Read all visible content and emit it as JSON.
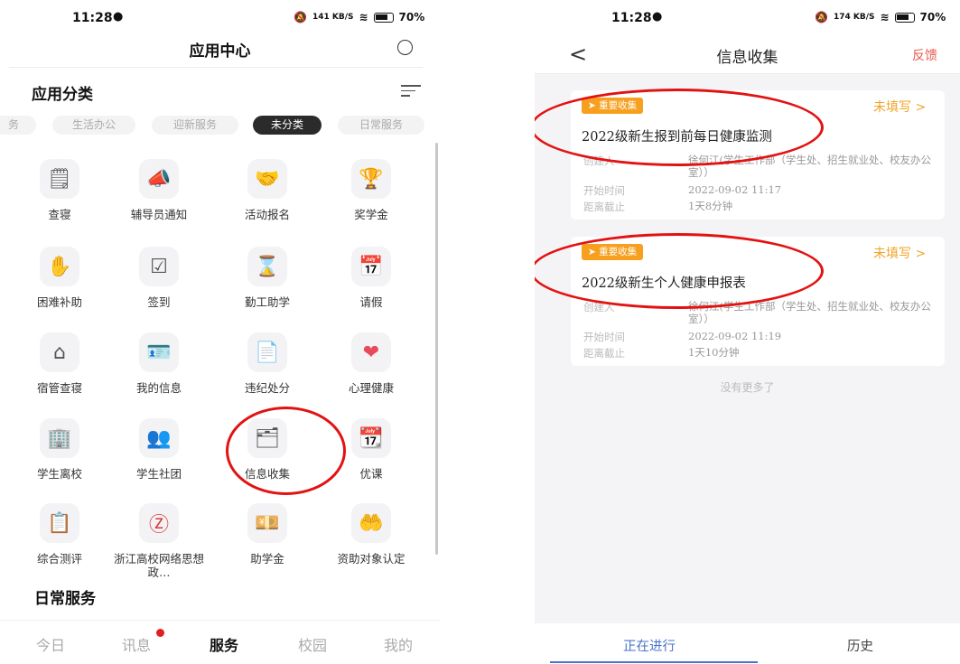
{
  "left": {
    "status": {
      "time": "11:28",
      "speed": "141 KB/S",
      "battery": "70%"
    },
    "title": "应用中心",
    "category_title": "应用分类",
    "chips": [
      "务",
      "生活办公",
      "迎新服务",
      "未分类",
      "日常服务"
    ],
    "active_chip": "未分类",
    "apps": [
      {
        "label": "查寝",
        "icon": "clipboard-check-icon",
        "color": "#555555",
        "glyph": "🗒"
      },
      {
        "label": "辅导员通知",
        "icon": "megaphone-icon",
        "color": "#555555",
        "glyph": "📣"
      },
      {
        "label": "活动报名",
        "icon": "handshake-icon",
        "color": "#555555",
        "glyph": "🤝"
      },
      {
        "label": "奖学金",
        "icon": "trophy-icon",
        "color": "#f07a2a",
        "glyph": "🏆"
      },
      {
        "label": "困难补助",
        "icon": "hand-coin-icon",
        "color": "#f0b84a",
        "glyph": "✋"
      },
      {
        "label": "签到",
        "icon": "checkin-icon",
        "color": "#555555",
        "glyph": "☑"
      },
      {
        "label": "勤工助学",
        "icon": "hourglass-icon",
        "color": "#3cb4a0",
        "glyph": "⌛"
      },
      {
        "label": "请假",
        "icon": "calendar-clock-icon",
        "color": "#555555",
        "glyph": "📅"
      },
      {
        "label": "宿管查寝",
        "icon": "home-heart-icon",
        "color": "#555555",
        "glyph": "⌂"
      },
      {
        "label": "我的信息",
        "icon": "id-card-icon",
        "color": "#555555",
        "glyph": "🪪"
      },
      {
        "label": "违纪处分",
        "icon": "document-red-icon",
        "color": "#e8503a",
        "glyph": "📄"
      },
      {
        "label": "心理健康",
        "icon": "heart-icon",
        "color": "#e84a5a",
        "glyph": "❤"
      },
      {
        "label": "学生离校",
        "icon": "building-icon",
        "color": "#3a6ad8",
        "glyph": "🏢"
      },
      {
        "label": "学生社团",
        "icon": "group-icon",
        "color": "#e87a3a",
        "glyph": "👥"
      },
      {
        "label": "信息收集",
        "icon": "info-collect-icon",
        "color": "#555555",
        "glyph": "🗂"
      },
      {
        "label": "优课",
        "icon": "vooc-calendar-icon",
        "color": "#555555",
        "glyph": "📆"
      },
      {
        "label": "综合测评",
        "icon": "resume-icon",
        "color": "#2aa8a0",
        "glyph": "📋"
      },
      {
        "label": "浙江高校网络思想政…",
        "icon": "zz-logo-icon",
        "color": "#d83a3a",
        "glyph": "Ⓩ"
      },
      {
        "label": "助学金",
        "icon": "money-icon",
        "color": "#e8503a",
        "glyph": "💴"
      },
      {
        "label": "资助对象认定",
        "icon": "hands-heart-icon",
        "color": "#f0a040",
        "glyph": "🤲"
      }
    ],
    "section_daily": "日常服务",
    "tabs": [
      "今日",
      "讯息",
      "服务",
      "校园",
      "我的"
    ],
    "active_tab": "服务"
  },
  "right": {
    "status": {
      "time": "11:28",
      "speed": "174 KB/S",
      "battery": "70%"
    },
    "title": "信息收集",
    "feedback": "反馈",
    "cards": [
      {
        "tag": "重要收集",
        "status": "未填写 >",
        "title": "2022级新生报到前每日健康监测",
        "creator_label": "创建人",
        "creator": "徐何江(学生工作部（学生处、招生就业处、校友办公室））",
        "start_label": "开始时间",
        "start": "2022-09-02 11:17",
        "deadline_label": "距离截止",
        "deadline": "1天8分钟"
      },
      {
        "tag": "重要收集",
        "status": "未填写 >",
        "title": "2022级新生个人健康申报表",
        "creator_label": "创建人",
        "creator": "徐何江(学生工作部（学生处、招生就业处、校友办公室））",
        "start_label": "开始时间",
        "start": "2022-09-02 11:19",
        "deadline_label": "距离截止",
        "deadline": "1天10分钟"
      }
    ],
    "no_more": "没有更多了",
    "tabs": [
      "正在进行",
      "历史"
    ]
  },
  "colors": {
    "annotation": "#e31212",
    "accent_blue": "#4a73c9",
    "tag_orange": "#f7a01f"
  }
}
